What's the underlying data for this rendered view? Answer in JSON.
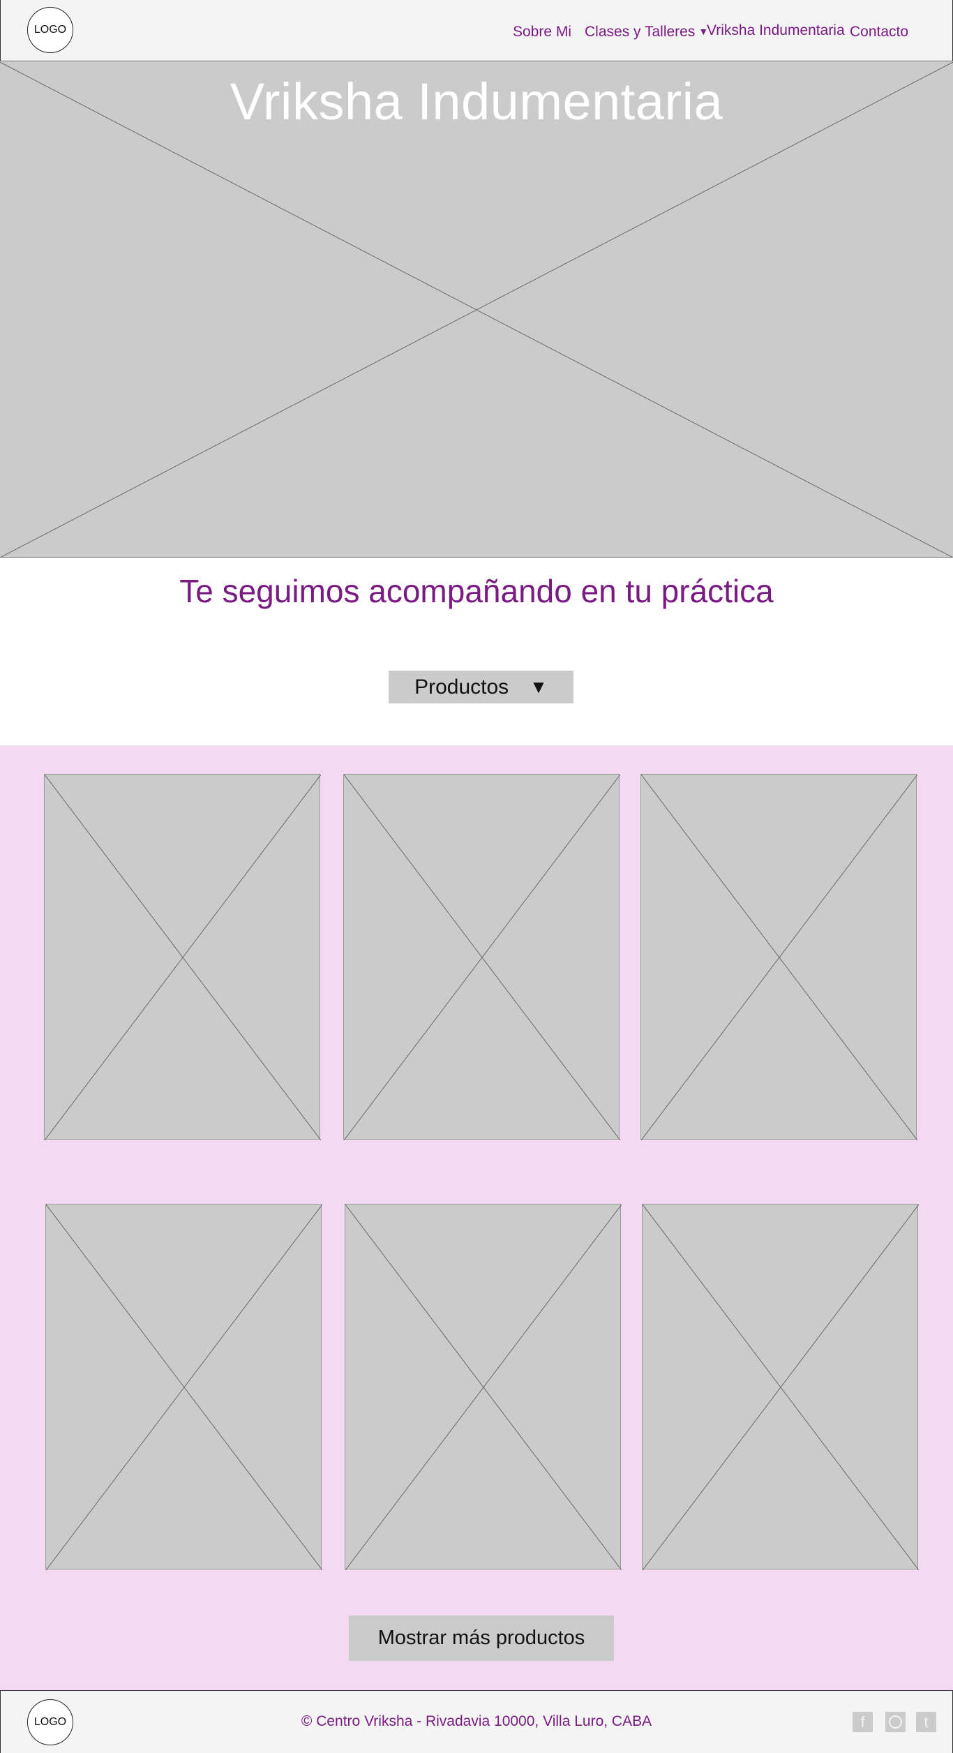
{
  "header": {
    "logo_label": "LOGO",
    "nav": {
      "about": "Sobre Mi",
      "classes": "Clases y Talleres",
      "classes_caret": "▼",
      "clothing": "Vriksha Indumentaria",
      "contact": "Contacto"
    }
  },
  "hero": {
    "title": "Vriksha Indumentaria"
  },
  "main": {
    "subtitle": "Te seguimos acompañando en tu práctica",
    "dropdown": {
      "label": "Productos",
      "caret": "▼"
    },
    "show_more_label": "Mostrar más productos"
  },
  "products": {
    "count": 6
  },
  "footer": {
    "logo_label": "LOGO",
    "text": "© Centro Vriksha - Rivadavia 10000, Villa Luro, CABA",
    "social": {
      "facebook": "f",
      "tumblr": "t"
    }
  },
  "colors": {
    "accent": "#7a1a83",
    "placeholder_gray": "#cbcbcb",
    "section_pink": "#f4d9f3",
    "header_bg": "#f4f4f4"
  }
}
